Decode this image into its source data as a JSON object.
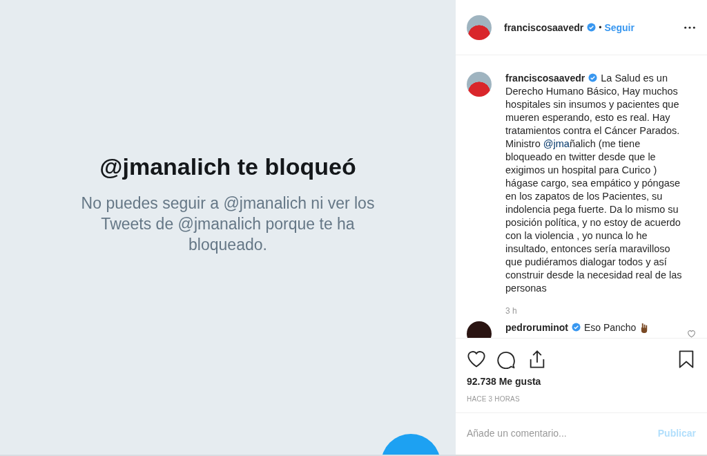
{
  "blocked_notice": {
    "title": "@jmanalich te bloqueó",
    "message": "No puedes seguir a @jmanalich ni ver los Tweets de @jmanalich porque te ha bloqueado."
  },
  "post_header": {
    "username": "franciscosaavedr",
    "verified": true,
    "separator": "•",
    "follow_label": "Seguir"
  },
  "caption": {
    "username": "franciscosaavedr",
    "verified": true,
    "segments": [
      {
        "kind": "text",
        "text": "La Salud es un Derecho Humano Básico, Hay muchos hospitales sin insumos y pacientes que mueren esperando, esto es real. Hay tratamientos contra el Cáncer Parados. Ministro "
      },
      {
        "kind": "mention",
        "text": "@jma"
      },
      {
        "kind": "text",
        "text": "ñalich (me tiene bloqueado en twitter desde que le exigimos un hospital para Curico ) hágase cargo, sea empático y póngase en los zapatos de los Pacientes, su indolencia pega fuerte. Da lo mismo su posición política, y no estoy de acuerdo con la violencia , yo nunca lo he insultado, entonces sería maravilloso que pudiéramos dialogar todos y así construir desde la necesidad real de las personas"
      }
    ],
    "time": "3 h"
  },
  "comments": [
    {
      "username": "pedroruminot",
      "verified": true,
      "text": "Eso Pancho",
      "liked": false
    }
  ],
  "likes": "92.738 Me gusta",
  "posted": "HACE 3 HORAS",
  "comment_box": {
    "placeholder": "Añade un comentario...",
    "submit_label": "Publicar",
    "disabled": true
  }
}
